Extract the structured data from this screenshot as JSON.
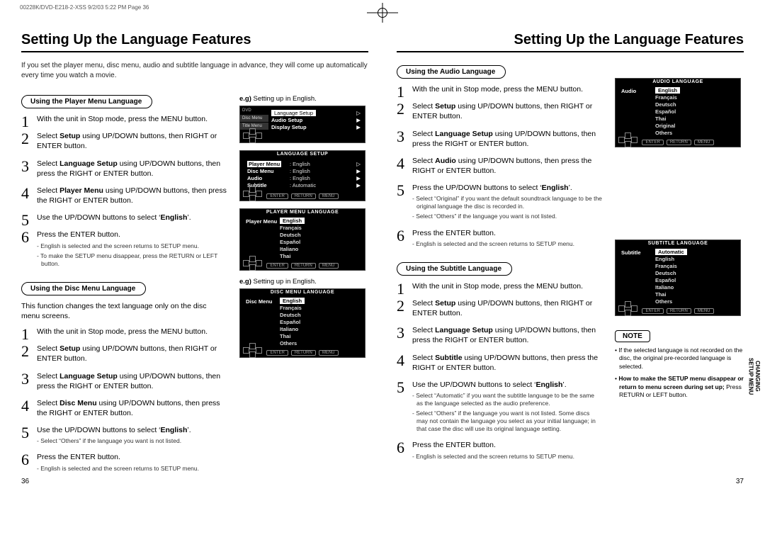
{
  "header": "00228K/DVD-E218-2-XSS  9/2/03 5:22 PM  Page 36",
  "title": "Setting Up the Language Features",
  "intro": "If you set the player menu, disc menu, audio and subtitle language in advance, they will come up automatically every time you watch a movie.",
  "sections": {
    "player": {
      "label": "Using the Player Menu Language",
      "steps": [
        {
          "t": "With the unit in Stop mode, press the MENU button."
        },
        {
          "t": "Select <b>Setup</b> using UP/DOWN buttons, then RIGHT or ENTER button."
        },
        {
          "t": "Select <b>Language Setup</b> using UP/DOWN buttons, then press the RIGHT or ENTER button."
        },
        {
          "t": "Select <b>Player Menu</b> using UP/DOWN buttons, then press the RIGHT or ENTER button."
        },
        {
          "t": "Use the UP/DOWN buttons to select ‘<b>English</b>’."
        },
        {
          "t": "Press the ENTER button.",
          "notes": [
            "- English is selected and the screen returns to SETUP menu.",
            "- To make the SETUP menu disappear, press the RETURN or LEFT button."
          ]
        }
      ]
    },
    "disc": {
      "label": "Using the Disc Menu Language",
      "intro": "This function changes the text language only on the disc menu screens.",
      "steps": [
        {
          "t": "With the unit in Stop mode, press the MENU button."
        },
        {
          "t": "Select <b>Setup</b> using UP/DOWN buttons, then RIGHT or ENTER button."
        },
        {
          "t": "Select <b>Language Setup</b> using UP/DOWN buttons, then press the RIGHT or ENTER button."
        },
        {
          "t": "Select <b>Disc Menu</b> using UP/DOWN buttons, then press the RIGHT or ENTER button."
        },
        {
          "t": "Use the UP/DOWN buttons to select ‘<b>English</b>’.",
          "notes": [
            "- Select “Others” if the language you want is not listed."
          ]
        },
        {
          "t": "Press the ENTER button.",
          "notes": [
            "- English is selected and the screen returns to SETUP menu."
          ]
        }
      ]
    },
    "audio": {
      "label": "Using the Audio Language",
      "steps": [
        {
          "t": "With the unit in Stop mode, press the MENU button."
        },
        {
          "t": "Select <b>Setup</b> using UP/DOWN buttons, then RIGHT or ENTER button."
        },
        {
          "t": "Select <b>Language Setup</b> using UP/DOWN buttons, then press the RIGHT or ENTER button."
        },
        {
          "t": "Select <b>Audio</b> using UP/DOWN buttons, then press the RIGHT or ENTER button."
        },
        {
          "t": "Press the UP/DOWN buttons to select ‘<b>English</b>’.",
          "notes": [
            "- Select “Original” if you want the default soundtrack language to be the original language the disc is recorded in.",
            "- Select “Others” if the language you want is not listed."
          ]
        },
        {
          "t": "Press the ENTER button.",
          "notes": [
            "- English is selected and the screen returns to SETUP menu."
          ]
        }
      ]
    },
    "subtitle": {
      "label": "Using the Subtitle Language",
      "steps": [
        {
          "t": "With the unit in Stop mode, press the MENU button."
        },
        {
          "t": "Select <b>Setup</b> using UP/DOWN buttons, then RIGHT or ENTER button."
        },
        {
          "t": "Select <b>Language Setup</b> using UP/DOWN buttons, then press the RIGHT or ENTER button."
        },
        {
          "t": "Select <b>Subtitle</b> using UP/DOWN buttons, then press the RIGHT or ENTER button."
        },
        {
          "t": "Use the UP/DOWN buttons to select ‘<b>English</b>’.",
          "notes": [
            "- Select “Automatic” if you want the subtitle language to be the same as the language selected as the audio preference.",
            "- Select “Others” if the language you want is not listed. Some discs may not contain the language you  select as your initial language; in that case the disc will use its original language setting."
          ]
        },
        {
          "t": "Press the ENTER button.",
          "notes": [
            "- English is selected and the screen returns to SETUP menu."
          ]
        }
      ]
    }
  },
  "eg_label": "e.g)",
  "eg_text": "Setting up in English.",
  "osd": {
    "dvd": "DVD",
    "setup_tabs": [
      "Disc Menu",
      "Title Menu"
    ],
    "setup_rows": [
      {
        "k": "Language Setup",
        "hl": true
      },
      {
        "k": "Audio Setup"
      },
      {
        "k": "Display Setup"
      }
    ],
    "lang_title": "LANGUAGE SETUP",
    "lang_rows": [
      {
        "k": "Player Menu",
        "v": "English",
        "hl": true
      },
      {
        "k": "Disc Menu",
        "v": "English"
      },
      {
        "k": "Audio",
        "v": "English"
      },
      {
        "k": "Subtitle",
        "v": "Automatic"
      }
    ],
    "player_title": "PLAYER MENU LANGUAGE",
    "player_left": "Player Menu",
    "player_list": [
      "English",
      "Français",
      "Deutsch",
      "Español",
      "Italiano",
      "Thai"
    ],
    "disc_title": "DISC MENU LANGUAGE",
    "disc_left": "Disc Menu",
    "disc_list": [
      "English",
      "Français",
      "Deutsch",
      "Español",
      "Italiano",
      "Thai",
      "Others"
    ],
    "audio_title": "AUDIO LANGUAGE",
    "audio_left": "Audio",
    "audio_list": [
      "English",
      "Français",
      "Deutsch",
      "Español",
      "Thai",
      "Original",
      "Others"
    ],
    "sub_title": "SUBTITLE LANGUAGE",
    "sub_left": "Subtitle",
    "sub_list": [
      "Automatic",
      "English",
      "Français",
      "Deutsch",
      "Español",
      "Italiano",
      "Thai",
      "Others"
    ],
    "btn1": "ENTER",
    "btn2": "RETURN",
    "btn3": "MENU"
  },
  "note_label": "NOTE",
  "notes": [
    "• If the selected language is not recorded on the disc, the original pre-recorded language is selected.",
    "• <b>How to make the SETUP menu disappear or return to menu screen during set up;</b> Press RETURN or LEFT button."
  ],
  "side_label": "CHANGING\nSETUP MENU",
  "page_left": "36",
  "page_right": "37"
}
